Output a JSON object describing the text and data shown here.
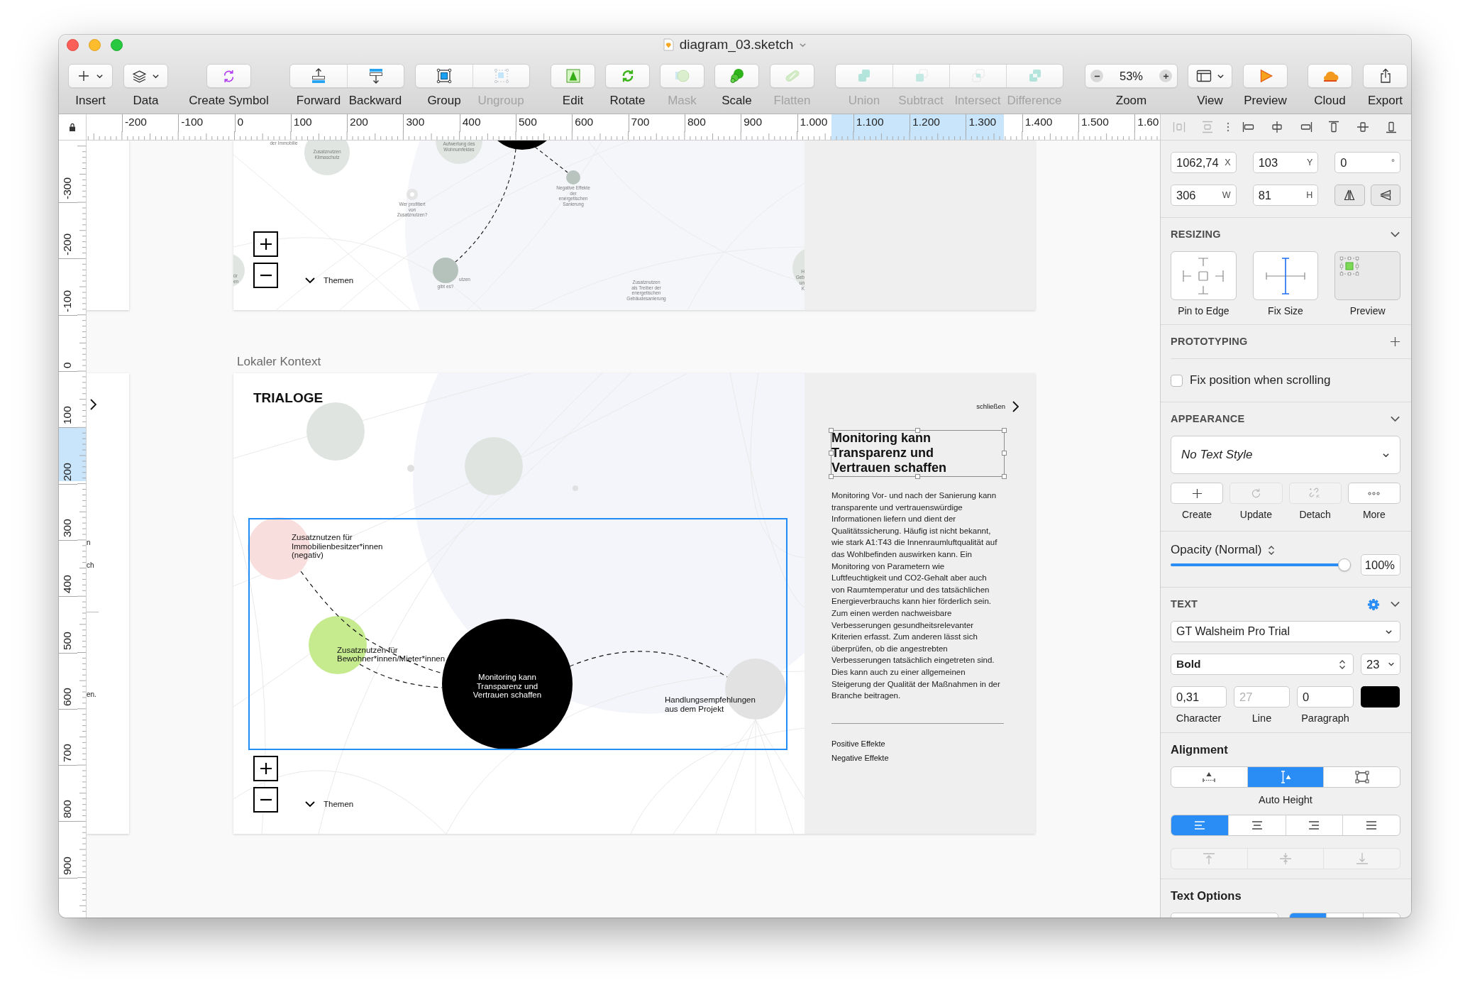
{
  "window": {
    "title": "diagram_03.sketch"
  },
  "toolbar": [
    {
      "kind": "button",
      "items": [
        {
          "label": "Insert",
          "disabled": false
        }
      ]
    },
    {
      "kind": "button",
      "items": [
        {
          "label": "Data",
          "disabled": false
        }
      ]
    },
    {
      "kind": "button",
      "items": [
        {
          "label": "Create Symbol",
          "disabled": false
        }
      ]
    },
    {
      "kind": "segmented",
      "items": [
        {
          "label": "Forward",
          "disabled": false
        },
        {
          "label": "Backward",
          "disabled": false
        }
      ]
    },
    {
      "kind": "segmented",
      "items": [
        {
          "label": "Group",
          "disabled": false
        },
        {
          "label": "Ungroup",
          "disabled": true
        }
      ]
    },
    {
      "kind": "button",
      "items": [
        {
          "label": "Edit",
          "disabled": false
        }
      ]
    },
    {
      "kind": "button",
      "items": [
        {
          "label": "Rotate",
          "disabled": false
        }
      ]
    },
    {
      "kind": "button",
      "items": [
        {
          "label": "Mask",
          "disabled": true
        }
      ]
    },
    {
      "kind": "button",
      "items": [
        {
          "label": "Scale",
          "disabled": false
        }
      ]
    },
    {
      "kind": "button",
      "items": [
        {
          "label": "Flatten",
          "disabled": true
        }
      ]
    },
    {
      "kind": "segmented",
      "items": [
        {
          "label": "Union",
          "disabled": true
        },
        {
          "label": "Subtract",
          "disabled": true
        },
        {
          "label": "Intersect",
          "disabled": true
        },
        {
          "label": "Difference",
          "disabled": true
        }
      ]
    },
    {
      "kind": "zoom",
      "value": "53%",
      "items": [
        {
          "label": "Zoom",
          "disabled": false
        }
      ]
    },
    {
      "kind": "button",
      "items": [
        {
          "label": "View",
          "disabled": false
        }
      ]
    },
    {
      "kind": "button",
      "items": [
        {
          "label": "Preview",
          "disabled": false
        }
      ]
    },
    {
      "kind": "button",
      "items": [
        {
          "label": "Cloud",
          "disabled": false
        }
      ]
    },
    {
      "kind": "button",
      "items": [
        {
          "label": "Export",
          "disabled": false
        }
      ]
    }
  ],
  "rulers": {
    "horizontal": [
      {
        "text": "-200",
        "highlighted": false
      },
      {
        "text": "-100",
        "highlighted": false
      },
      {
        "text": "0",
        "highlighted": false
      },
      {
        "text": "100",
        "highlighted": false
      },
      {
        "text": "200",
        "highlighted": false
      },
      {
        "text": "300",
        "highlighted": false
      },
      {
        "text": "400",
        "highlighted": false
      },
      {
        "text": "500",
        "highlighted": false
      },
      {
        "text": "600",
        "highlighted": false
      },
      {
        "text": "700",
        "highlighted": false
      },
      {
        "text": "800",
        "highlighted": false
      },
      {
        "text": "900",
        "highlighted": false
      },
      {
        "text": "1.000",
        "highlighted": false
      },
      {
        "text": "1.100",
        "highlighted": true
      },
      {
        "text": "1.200",
        "highlighted": true
      },
      {
        "text": "1.300",
        "highlighted": true
      },
      {
        "text": "1.400",
        "highlighted": false
      },
      {
        "text": "1.500",
        "highlighted": false
      },
      {
        "text": "1.60",
        "highlighted": false
      }
    ],
    "vertical": [
      {
        "text": "-300",
        "highlighted": false
      },
      {
        "text": "-200",
        "highlighted": false
      },
      {
        "text": "-100",
        "highlighted": false
      },
      {
        "text": "0",
        "highlighted": false
      },
      {
        "text": "100",
        "highlighted": false
      },
      {
        "text": "200",
        "highlighted": true
      },
      {
        "text": "300",
        "highlighted": false
      },
      {
        "text": "400",
        "highlighted": false
      },
      {
        "text": "500",
        "highlighted": false
      },
      {
        "text": "600",
        "highlighted": false
      },
      {
        "text": "700",
        "highlighted": false
      },
      {
        "text": "800",
        "highlighted": false
      },
      {
        "text": "900",
        "highlighted": false
      }
    ]
  },
  "canvas": {
    "left_artboard": {
      "texts": [
        "n",
        "ch",
        "en."
      ]
    },
    "top_artboard": {
      "fragment": "der Immobilie",
      "nodes": [
        {
          "label": "Zusatznutzen\nKlimaschutz"
        },
        {
          "label": "Aufwertung des\nWohnumfeldes"
        },
        {
          "label": "Wer profitiert\nvon\nZusatznutzen?"
        },
        {
          "label": "Negative Effekte\nder\nenergetischen\nSanierung"
        },
        {
          "label": "gibt es?"
        },
        {
          "label": "Zusatznutzen\nals Treiber der\nenergetischen\nGebäudesanierung"
        }
      ],
      "partial_texts": [
        "ür",
        "en",
        "utzen",
        "H",
        "Geb",
        "un",
        "K"
      ],
      "topics": "Themen"
    },
    "artboard": {
      "name": "Lokaler Kontext",
      "title": "TRIALOGE",
      "group_highlighted": true,
      "nodes": [
        {
          "label": "Zusatznutzen für\nImmobilienbesitzer*innen\n(negativ)",
          "color": "#f9dede"
        },
        {
          "label": "Zusatznutzen für\nBewohner*innen/Mieter*innen",
          "color": "#c6eb8f"
        },
        {
          "label": "Monitoring kann\nTransparenz und\nVertrauen schaffen",
          "color": "#000000"
        },
        {
          "label": "Handlungsempfehlungen\naus dem Projekt",
          "color": "#e2e2e2"
        }
      ],
      "topics": "Themen",
      "panel": {
        "close": "schließen",
        "heading": "Monitoring kann\nTransparenz und\nVertrauen schaffen",
        "heading_selected": true,
        "body": "Monitoring Vor- und nach der Sanierung kann\ntransparente und vertrauenswürdige\nInformationen liefern und dient der\nQualitätssicherung. Häufig ist nicht bekannt,\nwie stark A1:T43 die Innenraumluftqualität auf\ndas Wohlbefinden auswirken kann. Ein\nMonitoring von Parametern wie\nLuftfeuchtigkeit und CO2-Gehalt aber auch\nvon Raumtemperatur und des tatsächlichen\nEnergieverbrauchs kann hier förderlich sein.\nZum einen werden nachweisbare\nVerbesserungen gesundheitsrelevanter\nKriterien erfasst. Zum anderen lässt sich\nüberprüfen, ob die angestrebten\nVerbesserungen tatsächlich eingetreten sind.\nDies kann auch zu einer allgemeinen\nSteigerung der Qualität der Maßnahmen in der\nBranche beitragen.",
        "links": [
          "Positive Effekte",
          "Negative Effekte"
        ]
      }
    }
  },
  "inspector": {
    "align_tools": [
      {
        "disabled": true
      },
      {
        "disabled": true
      },
      {
        "disabled": false
      },
      {
        "disabled": false
      },
      {
        "disabled": false
      },
      {
        "disabled": false
      },
      {
        "disabled": false
      },
      {
        "disabled": false
      }
    ],
    "position": [
      {
        "value": "1062,74",
        "unit": "X"
      },
      {
        "value": "103",
        "unit": "Y"
      },
      {
        "value": "0",
        "unit": "°"
      }
    ],
    "size": [
      {
        "value": "306",
        "unit": "W"
      },
      {
        "value": "81",
        "unit": "H"
      }
    ],
    "resizing": {
      "title": "RESIZING",
      "expanded": true,
      "options": [
        "Pin to Edge",
        "Fix Size",
        "Preview"
      ]
    },
    "prototyping": {
      "title": "PROTOTYPING",
      "checkbox": {
        "label": "Fix position when scrolling",
        "checked": false
      }
    },
    "appearance": {
      "title": "APPEARANCE",
      "expanded": true,
      "text_style": "No Text Style",
      "actions": [
        {
          "label": "Create",
          "disabled": false
        },
        {
          "label": "Update",
          "disabled": true
        },
        {
          "label": "Detach",
          "disabled": true
        },
        {
          "label": "More",
          "disabled": false
        }
      ],
      "opacity": {
        "label": "Opacity (Normal)",
        "level": 1,
        "value": "100%"
      }
    },
    "text": {
      "title": "TEXT",
      "expanded": true,
      "font": "GT Walsheim Pro Trial",
      "weight": "Bold",
      "size": "23",
      "spacing": [
        {
          "label": "Character",
          "value": "0,31"
        },
        {
          "label": "Line",
          "placeholder": "27"
        },
        {
          "label": "Paragraph",
          "value": "0"
        }
      ],
      "color": "#000000"
    },
    "alignment": {
      "title": "Alignment",
      "sizing": [
        {
          "selected": false
        },
        {
          "selected": true
        },
        {
          "selected": false
        }
      ],
      "sizing_label": "Auto Height",
      "horizontal": [
        {
          "selected": true
        },
        {
          "selected": false
        },
        {
          "selected": false
        },
        {
          "selected": false
        }
      ],
      "vertical": {
        "disabled": true,
        "items": [
          {
            "selected": false
          },
          {
            "selected": false
          },
          {
            "selected": false
          }
        ]
      }
    },
    "text_options": {
      "title": "Text Options",
      "segments": [
        {
          "selected": true
        },
        {
          "selected": false
        },
        {
          "selected": false
        }
      ]
    }
  }
}
